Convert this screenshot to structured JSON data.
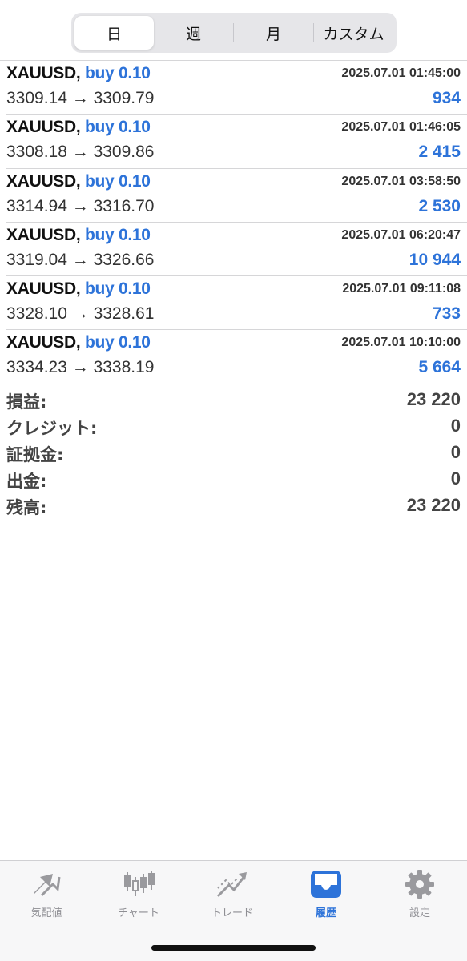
{
  "period_tabs": [
    "日",
    "週",
    "月",
    "カスタム"
  ],
  "active_period": 0,
  "trades": [
    {
      "symbol": "XAUUSD,",
      "side": "buy 0.10",
      "time": "2025.07.01 01:45:00",
      "prices": "3309.14 → 3309.79",
      "profit": "934"
    },
    {
      "symbol": "XAUUSD,",
      "side": "buy 0.10",
      "time": "2025.07.01 01:46:05",
      "prices": "3308.18 → 3309.86",
      "profit": "2 415"
    },
    {
      "symbol": "XAUUSD,",
      "side": "buy 0.10",
      "time": "2025.07.01 03:58:50",
      "prices": "3314.94 → 3316.70",
      "profit": "2 530"
    },
    {
      "symbol": "XAUUSD,",
      "side": "buy 0.10",
      "time": "2025.07.01 06:20:47",
      "prices": "3319.04 → 3326.66",
      "profit": "10 944"
    },
    {
      "symbol": "XAUUSD,",
      "side": "buy 0.10",
      "time": "2025.07.01 09:11:08",
      "prices": "3328.10 → 3328.61",
      "profit": "733"
    },
    {
      "symbol": "XAUUSD,",
      "side": "buy 0.10",
      "time": "2025.07.01 10:10:00",
      "prices": "3334.23 → 3338.19",
      "profit": "5 664"
    }
  ],
  "summary": [
    {
      "label": "損益:",
      "value": "23 220"
    },
    {
      "label": "クレジット:",
      "value": "0"
    },
    {
      "label": "証拠金:",
      "value": "0"
    },
    {
      "label": "出金:",
      "value": "0"
    },
    {
      "label": "残高:",
      "value": "23 220"
    }
  ],
  "tabbar": [
    {
      "label": "気配値",
      "icon": "quotes-icon"
    },
    {
      "label": "チャート",
      "icon": "candlestick-chart-icon"
    },
    {
      "label": "トレード",
      "icon": "trade-icon"
    },
    {
      "label": "履歴",
      "icon": "history-inbox-icon"
    },
    {
      "label": "設定",
      "icon": "gear-icon"
    }
  ],
  "active_tab": 3,
  "colors": {
    "accent": "#2d73d9",
    "inactive": "#8e8e93"
  }
}
